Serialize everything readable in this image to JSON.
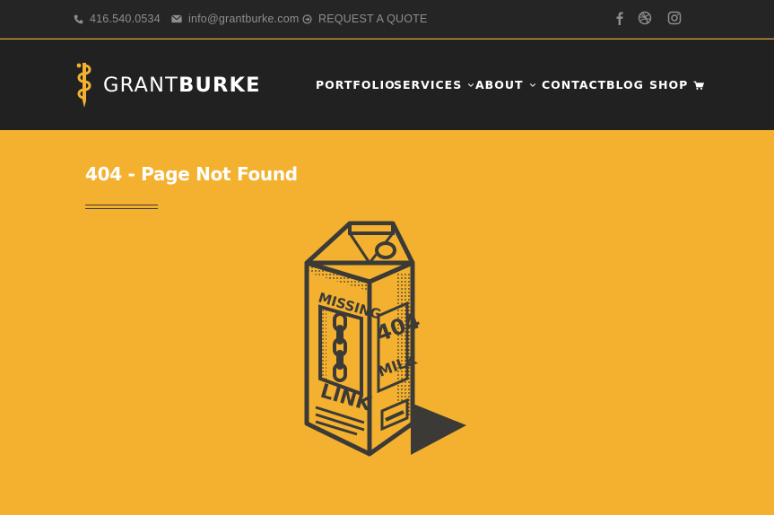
{
  "topbar": {
    "phone": "416.540.0534",
    "email": "info@grantburke.com",
    "quote": "REQUEST A QUOTE",
    "social": [
      "facebook-icon",
      "dribbble-icon",
      "instagram-icon"
    ]
  },
  "brand": {
    "part1": "GRANT",
    "part2": "BURKE"
  },
  "nav": {
    "portfolio": "PORTFOLIO",
    "services": "SERVICES",
    "about": "ABOUT",
    "contact": "CONTACT",
    "blog": "BLOG",
    "shop": "SHOP"
  },
  "page": {
    "title": "404 - Page Not Found"
  },
  "carton": {
    "missing": "MISSING",
    "link": "LINK",
    "code": "404",
    "milk": "MILK"
  },
  "colors": {
    "accent": "#f4b130",
    "header": "#212121",
    "topbar": "#252525",
    "ink": "#3b3a36"
  }
}
